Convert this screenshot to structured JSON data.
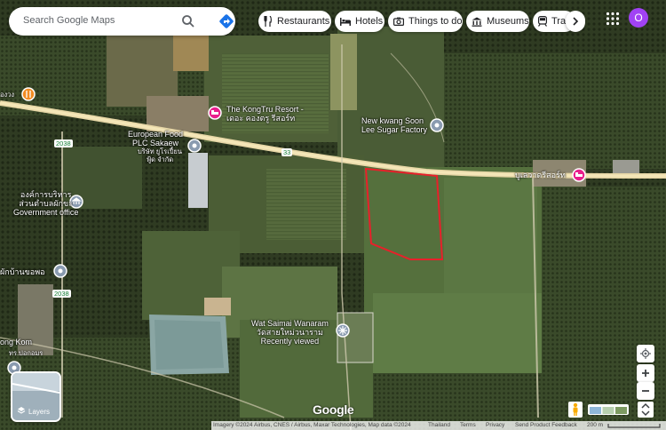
{
  "search": {
    "placeholder": "Search Google Maps"
  },
  "chips": [
    {
      "label": "Restaurants",
      "icon": "fork-knife-icon"
    },
    {
      "label": "Hotels",
      "icon": "bed-icon"
    },
    {
      "label": "Things to do",
      "icon": "camera-icon"
    },
    {
      "label": "Museums",
      "icon": "museum-icon"
    },
    {
      "label": "Tra",
      "icon": "train-icon"
    }
  ],
  "account": {
    "initial": "O",
    "color": "#a142f4"
  },
  "places": {
    "kongtru": {
      "line1": "The KongTru Resort -",
      "line2": "เดอะ คองตรู รีสอร์ท"
    },
    "european": {
      "line1": "European Food",
      "line2": "PLC Sakaew",
      "line3": "บริษัท ยูโรเปี้ยน",
      "line4": "ฟู้ด จำกัด"
    },
    "sugar": {
      "line1": "New kwang Soon",
      "line2": "Lee Sugar Factory"
    },
    "govt": {
      "line1": "องค์การบริหาร",
      "line2": "ส่วนตำบลผักขะ",
      "line3": "Government office"
    },
    "resort_right": {
      "line1": "บูเลวาดรีสอร์ท"
    },
    "pakban": {
      "line1": "ผักบ้านขอพอ"
    },
    "wat": {
      "line1": "Wat Saimai Wanaram",
      "line2": "วัดสายใหม่วนาราม",
      "line3": "Recently viewed"
    },
    "kongkom": {
      "line1": "ong Kom"
    },
    "kongkom_sub": {
      "line1": "ทร.ปอกอมร"
    },
    "topleft": {
      "line1": "องวง"
    }
  },
  "roads": {
    "r2038a": "2038",
    "r2038b": "2038",
    "r33": "33"
  },
  "controls": {
    "layers_label": "Layers"
  },
  "branding": {
    "logo": "Google"
  },
  "footer": {
    "imagery": "Imagery ©2024 Airbus, CNES / Airbus, Maxar Technologies, Map data ©2024",
    "thailand": "Thailand",
    "terms": "Terms",
    "privacy": "Privacy",
    "feedback": "Send Product Feedback",
    "scale": "200 m"
  },
  "colors": {
    "highlight_polygon": "#e8202a",
    "pin_pink": "#e91e8c",
    "pin_orange": "#f28b22",
    "pin_gray": "#8a9bb0"
  }
}
